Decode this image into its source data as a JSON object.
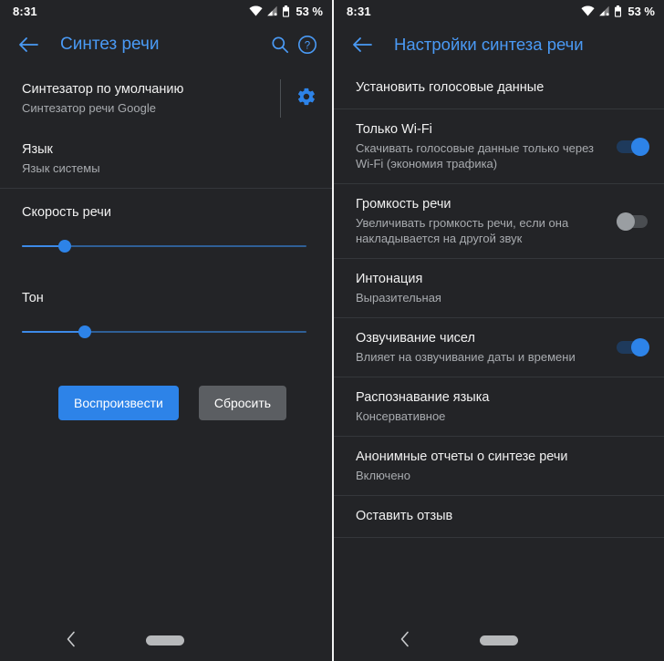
{
  "status_bar": {
    "clock": "8:31",
    "battery_percent": "53 %",
    "icons": [
      "wifi-icon",
      "cellular-signal-icon",
      "battery-icon"
    ]
  },
  "colors": {
    "background": "#232427",
    "accent_blue": "#2d83e8",
    "title_blue": "#4a9af5",
    "divider": "#34373b",
    "primary_text": "#f1f1f1",
    "secondary_text": "#a8abaf",
    "switch_on_thumb": "#2d83e8",
    "switch_off_thumb": "#9a9ea2"
  },
  "left_screen": {
    "appbar": {
      "back_icon": "arrow-back-icon",
      "title": "Синтез речи",
      "search_icon": "search-icon",
      "help_icon": "help-circle-icon"
    },
    "engine_row": {
      "title": "Синтезатор по умолчанию",
      "subtitle": "Синтезатор речи Google",
      "settings_icon": "gear-icon"
    },
    "language_row": {
      "title": "Язык",
      "subtitle": "Язык системы"
    },
    "speech_rate": {
      "label": "Скорость речи",
      "value_percent": 15
    },
    "pitch": {
      "label": "Тон",
      "value_percent": 22
    },
    "buttons": {
      "play": "Воспроизвести",
      "reset": "Сбросить"
    }
  },
  "right_screen": {
    "appbar": {
      "back_icon": "arrow-back-icon",
      "title": "Настройки синтеза речи"
    },
    "items": [
      {
        "title": "Установить голосовые данные",
        "subtitle": "",
        "control": "none"
      },
      {
        "title": "Только Wi-Fi",
        "subtitle": "Скачивать голосовые данные только через Wi-Fi (экономия трафика)",
        "control": "switch",
        "switch_state": "on"
      },
      {
        "title": "Громкость речи",
        "subtitle": "Увеличивать громкость речи, если она накладывается на другой звук",
        "control": "switch",
        "switch_state": "off"
      },
      {
        "title": "Интонация",
        "subtitle": "Выразительная",
        "control": "none"
      },
      {
        "title": "Озвучивание чисел",
        "subtitle": "Влияет на озвучивание даты и времени",
        "control": "switch",
        "switch_state": "on"
      },
      {
        "title": "Распознавание языка",
        "subtitle": "Консервативное",
        "control": "none"
      },
      {
        "title": "Анонимные отчеты о синтезе речи",
        "subtitle": "Включено",
        "control": "none"
      },
      {
        "title": "Оставить отзыв",
        "subtitle": "",
        "control": "none"
      }
    ]
  },
  "nav_bar": {
    "back_icon": "chevron-back-icon",
    "home_icon": "home-pill-icon"
  }
}
